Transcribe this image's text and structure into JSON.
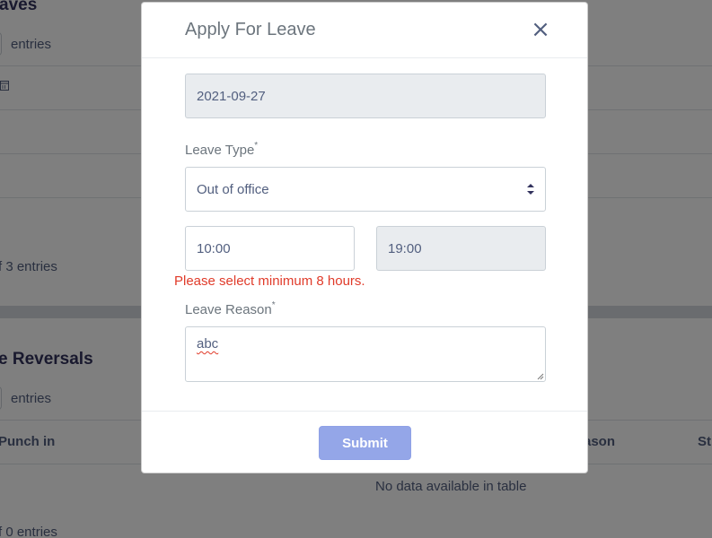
{
  "background": {
    "leaves_title_fragment": "aves",
    "entries_label_top": "entries",
    "info_top": "f 3 entries",
    "reversals_title_fragment": "e Reversals",
    "entries_label_bottom": "entries",
    "col_punch_in": "Punch in",
    "col_reason_fragment": "ason",
    "col_status_fragment": "St",
    "empty_table": "No data available in table",
    "info_bottom": "f 0 entries"
  },
  "modal": {
    "title": "Apply For Leave",
    "close_symbol": "×",
    "date_value": "2021-09-27",
    "leave_type_label": "Leave Type",
    "required_mark": "*",
    "leave_type_value": "Out of office",
    "start_time": "10:00",
    "end_time": "19:00",
    "error_message": "Please select minimum 8 hours.",
    "leave_reason_label": "Leave Reason",
    "leave_reason_value": "abc",
    "submit_label": "Submit"
  },
  "colors": {
    "error": "#e03b2a",
    "submit": "#94a6e8",
    "overlay": "rgba(0,0,0,0.5)"
  },
  "icons": {
    "close": "close-icon",
    "calendar": "calendar-icon",
    "select": "select-arrows-icon"
  }
}
